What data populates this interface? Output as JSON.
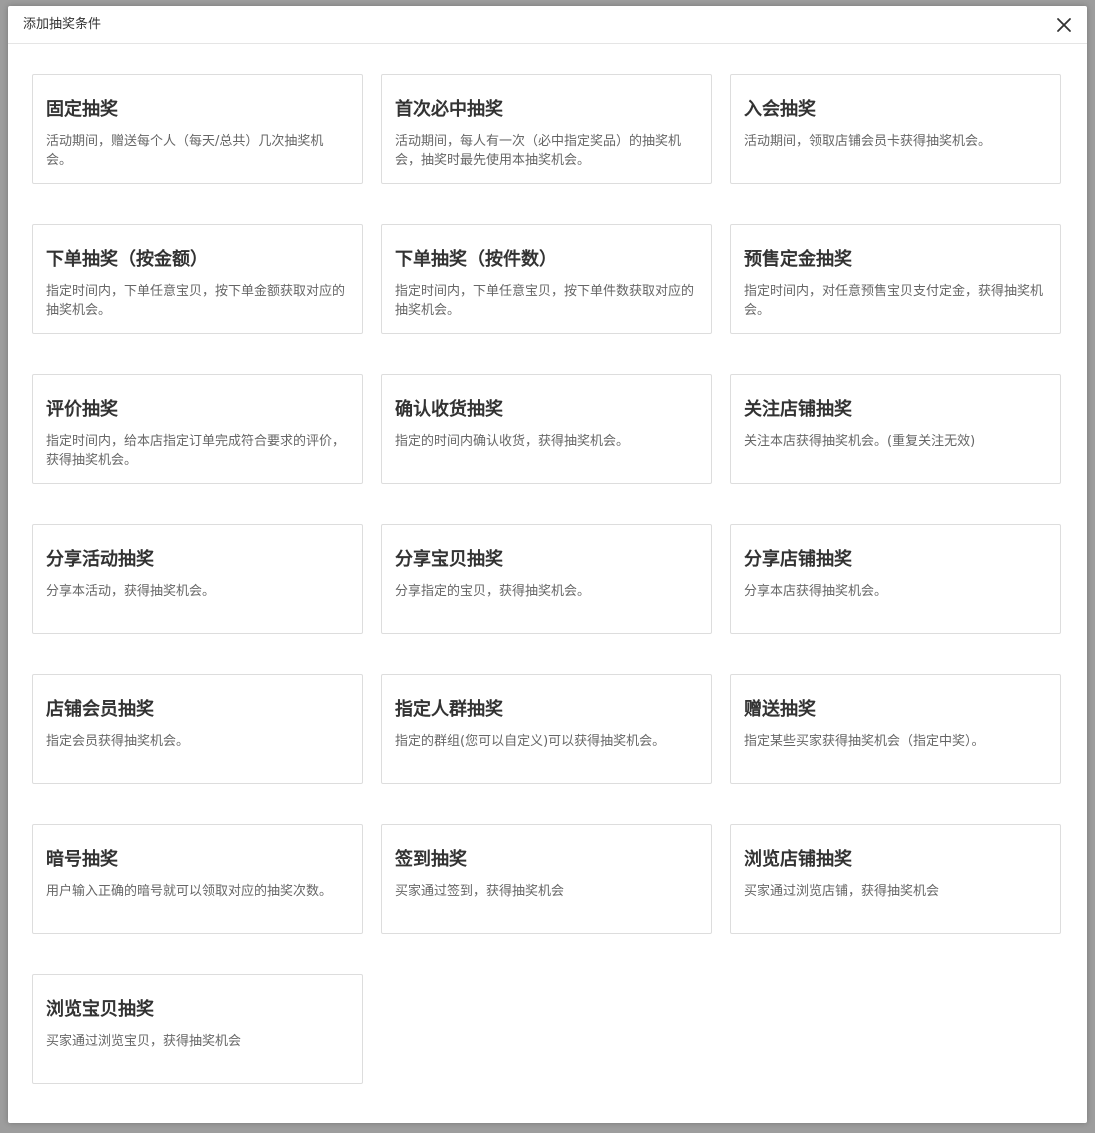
{
  "dialog": {
    "title": "添加抽奖条件",
    "close_icon": "close-icon"
  },
  "cards": [
    {
      "title": "固定抽奖",
      "desc": "活动期间，赠送每个人（每天/总共）几次抽奖机会。"
    },
    {
      "title": "首次必中抽奖",
      "desc": "活动期间，每人有一次（必中指定奖品）的抽奖机会，抽奖时最先使用本抽奖机会。"
    },
    {
      "title": "入会抽奖",
      "desc": "活动期间，领取店铺会员卡获得抽奖机会。"
    },
    {
      "title": "下单抽奖（按金额）",
      "desc": "指定时间内，下单任意宝贝，按下单金额获取对应的抽奖机会。"
    },
    {
      "title": "下单抽奖（按件数）",
      "desc": "指定时间内，下单任意宝贝，按下单件数获取对应的抽奖机会。"
    },
    {
      "title": "预售定金抽奖",
      "desc": "指定时间内，对任意预售宝贝支付定金，获得抽奖机会。"
    },
    {
      "title": "评价抽奖",
      "desc": "指定时间内，给本店指定订单完成符合要求的评价，获得抽奖机会。"
    },
    {
      "title": "确认收货抽奖",
      "desc": "指定的时间内确认收货，获得抽奖机会。"
    },
    {
      "title": "关注店铺抽奖",
      "desc": "关注本店获得抽奖机会。(重复关注无效)"
    },
    {
      "title": "分享活动抽奖",
      "desc": "分享本活动，获得抽奖机会。"
    },
    {
      "title": "分享宝贝抽奖",
      "desc": "分享指定的宝贝，获得抽奖机会。"
    },
    {
      "title": "分享店铺抽奖",
      "desc": "分享本店获得抽奖机会。"
    },
    {
      "title": "店铺会员抽奖",
      "desc": "指定会员获得抽奖机会。"
    },
    {
      "title": "指定人群抽奖",
      "desc": "指定的群组(您可以自定义)可以获得抽奖机会。"
    },
    {
      "title": "赠送抽奖",
      "desc": "指定某些买家获得抽奖机会（指定中奖）。"
    },
    {
      "title": "暗号抽奖",
      "desc": "用户输入正确的暗号就可以领取对应的抽奖次数。"
    },
    {
      "title": "签到抽奖",
      "desc": "买家通过签到，获得抽奖机会"
    },
    {
      "title": "浏览店铺抽奖",
      "desc": "买家通过浏览店铺，获得抽奖机会"
    },
    {
      "title": "浏览宝贝抽奖",
      "desc": "买家通过浏览宝贝，获得抽奖机会"
    }
  ]
}
